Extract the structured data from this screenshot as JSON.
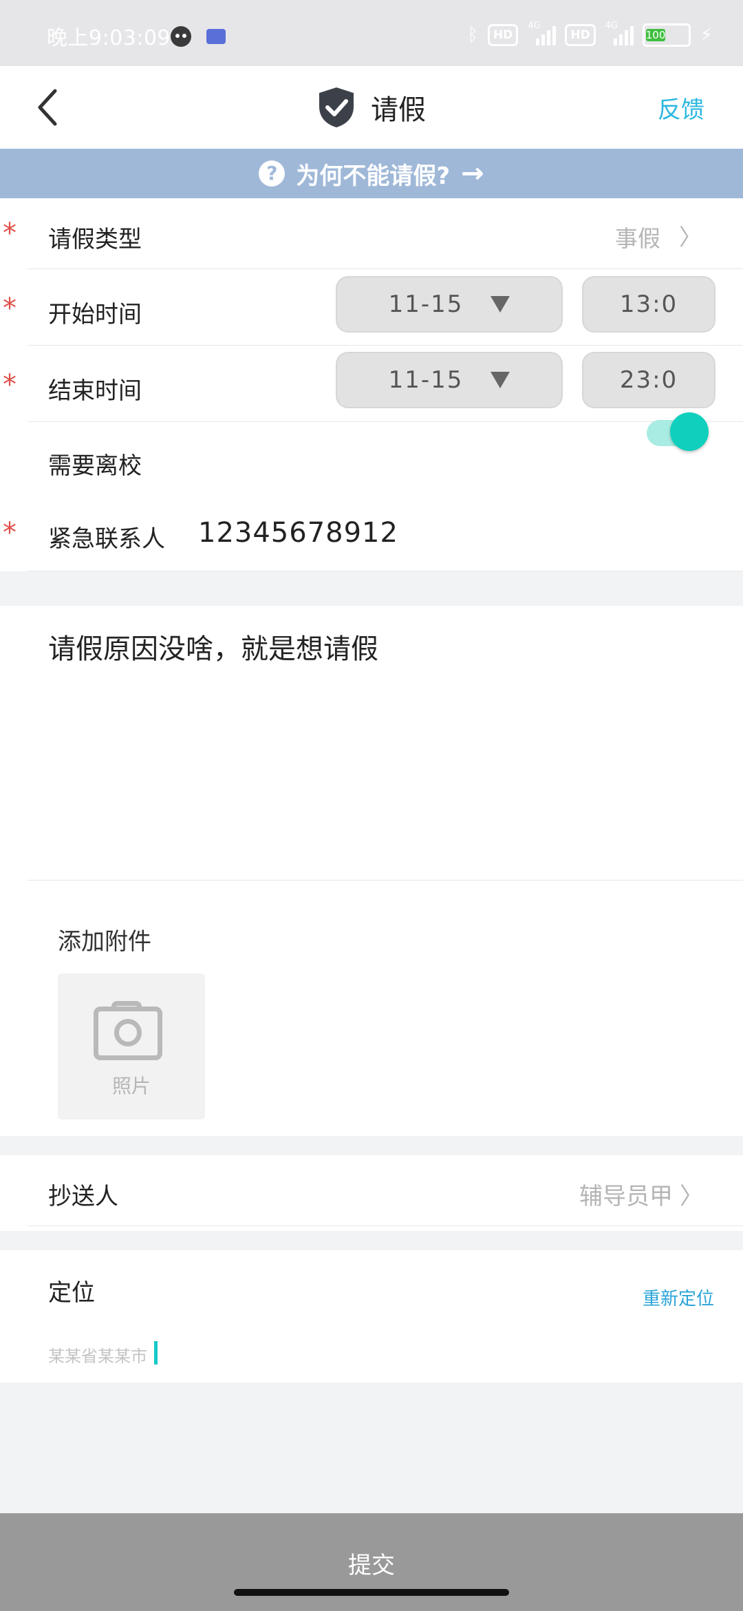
{
  "status_bar": {
    "time": "晚上9:03:09",
    "hd1": "HD",
    "hd2": "HD",
    "net1": "4G",
    "net2": "4G",
    "battery": "100"
  },
  "header": {
    "title": "请假",
    "feedback": "反馈",
    "back_icon": "chevron-left-icon",
    "title_icon": "shield-check-icon"
  },
  "banner": {
    "text": "为何不能请假?",
    "icon": "question-circle-icon",
    "arrow": "→"
  },
  "form": {
    "leave_type": {
      "label": "请假类型",
      "value": "事假",
      "chevron": "〉"
    },
    "start_time": {
      "label": "开始时间",
      "date": "11-15",
      "time": "13:0"
    },
    "end_time": {
      "label": "结束时间",
      "date": "11-15",
      "time": "23:0"
    },
    "leave_campus": {
      "label": "需要离校",
      "on": true
    },
    "emergency_contact": {
      "label": "紧急联系人",
      "value": "12345678912"
    },
    "required_mark": "*"
  },
  "reason": {
    "text": "请假原因没啥，就是想请假"
  },
  "attachment": {
    "title": "添加附件",
    "photo_label": "照片"
  },
  "cc": {
    "label": "抄送人",
    "value": "辅导员甲",
    "chevron": "〉"
  },
  "location": {
    "label": "定位",
    "relocate": "重新定位",
    "value": "某某省某某市"
  },
  "submit": {
    "label": "提交"
  },
  "colors": {
    "accent": "#2bb7e0",
    "toggle": "#0fd0bc",
    "required": "#e0504a",
    "banner": "#9fb8d8"
  }
}
